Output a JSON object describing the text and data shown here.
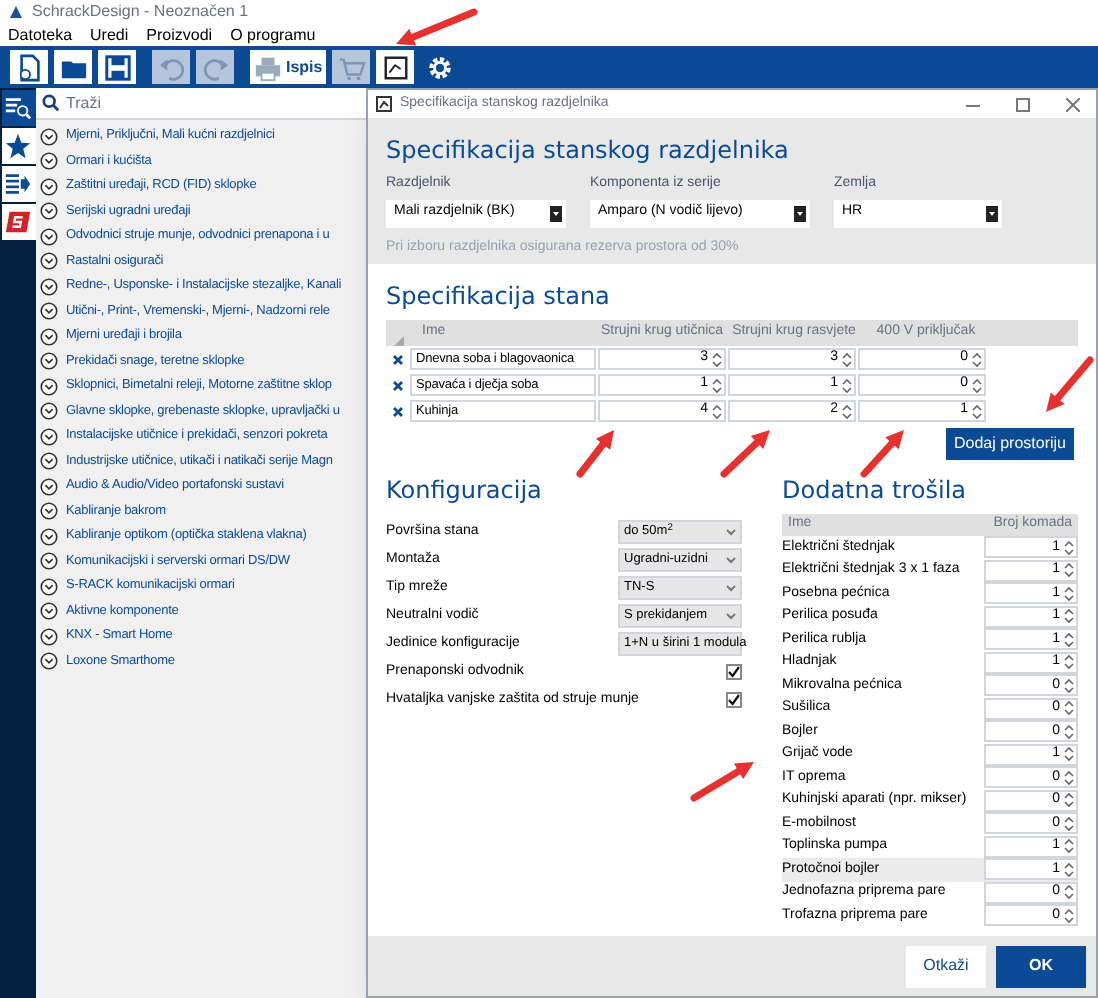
{
  "app_title": "SchrackDesign - Neoznačen 1",
  "menu": [
    "Datoteka",
    "Uredi",
    "Proizvodi",
    "O programu"
  ],
  "toolbar": [
    {
      "kind": "new",
      "disabled": false
    },
    {
      "kind": "open",
      "disabled": false
    },
    {
      "kind": "save",
      "disabled": false
    },
    {
      "kind": "undo",
      "disabled": true
    },
    {
      "kind": "redo",
      "disabled": true
    },
    {
      "kind": "print",
      "label": "Ispis",
      "disabled": false
    },
    {
      "kind": "cart",
      "disabled": true
    },
    {
      "kind": "spec",
      "disabled": false
    },
    {
      "kind": "settings",
      "disabled": false
    }
  ],
  "rail": [
    {
      "kind": "search-list",
      "selected": true
    },
    {
      "kind": "star",
      "selected": false
    },
    {
      "kind": "list-arrow",
      "selected": false
    },
    {
      "kind": "logo",
      "selected": false
    }
  ],
  "search": {
    "placeholder": "Traži"
  },
  "categories": [
    "Mjerni, Priključni, Mali kućni razdjelnici",
    "Ormari i kućišta",
    "Zaštitni uređaji, RCD (FID) sklopke",
    "Serijski ugradni uređaji",
    "Odvodnici struje munje, odvodnici prenapona i u",
    "Rastalni osigurači",
    "Redne-, Usponske- i Instalacijske stezaljke, Kanali",
    "Utični-, Print-, Vremenski-, Mjerni-, Nadzorni rele",
    "Mjerni uređaji i brojila",
    "Prekidači snage, teretne sklopke",
    "Sklopnici, Bimetalni releji, Motorne zaštitne sklop",
    "Glavne sklopke, grebenaste sklopke, upravljački u",
    "Instalacijske utičnice i prekidači, senzori pokreta",
    "Industrijske utičnice, utikači i natikači serije Magn",
    "Audio & Audio/Video portafonski sustavi",
    "Kabliranje bakrom",
    "Kabliranje optikom (optička staklena vlakna)",
    "Komunikacijski i serverski ormari DS/DW",
    "S-RACK komunikacijski ormari",
    "Aktivne komponente",
    "KNX - Smart Home",
    "Loxone Smarthome"
  ],
  "dialog": {
    "title": "Specifikacija stanskog razdjelnika",
    "heading": "Specifikacija stanskog razdjelnika",
    "fields": [
      {
        "label": "Razdjelnik",
        "value": "Mali razdjelnik (BK)"
      },
      {
        "label": "Komponenta iz serije",
        "value": "Amparo (N vodič lijevo)"
      },
      {
        "label": "Zemlja",
        "value": "HR"
      }
    ],
    "note": "Pri izboru razdjelnika osigurana rezerva prostora od 30%",
    "apartment": {
      "heading": "Specifikacija stana",
      "columns": [
        "Ime",
        "Strujni krug utičnica",
        "Strujni krug rasvjete",
        "400 V priključak"
      ],
      "rows": [
        {
          "name": "Dnevna soba i blagovaonica",
          "values": [
            "3",
            "3",
            "0"
          ]
        },
        {
          "name": "Spavaća i dječja soba",
          "values": [
            "1",
            "1",
            "0"
          ]
        },
        {
          "name": "Kuhinja",
          "values": [
            "4",
            "2",
            "1"
          ]
        }
      ],
      "add_button": "Dodaj prostoriju"
    },
    "config": {
      "heading": "Konfiguracija",
      "rows": [
        {
          "kind": "select",
          "label": "Površina stana",
          "value": "do 50m$^{2}$"
        },
        {
          "kind": "select",
          "label": "Montaža",
          "value": "Ugradni-uzidni"
        },
        {
          "kind": "select",
          "label": "Tip mreže",
          "value": "TN-S"
        },
        {
          "kind": "select",
          "label": "Neutralni vodič",
          "value": "S prekidanjem"
        },
        {
          "kind": "select",
          "label": "Jedinice konfiguracije",
          "value": "1+N u širini 1 modula"
        },
        {
          "kind": "checkbox",
          "label": "Prenaponski odvodnik",
          "checked": true
        },
        {
          "kind": "checkbox",
          "label": "Hvataljka vanjske zaštita od struje munje",
          "checked": true
        }
      ]
    },
    "consumers": {
      "heading": "Dodatna trošila",
      "columns": [
        "Ime",
        "Broj komada"
      ],
      "rows": [
        {
          "name": "Električni štednjak",
          "count": "1",
          "selected": false
        },
        {
          "name": "Električni štednjak 3 x 1 faza",
          "count": "1",
          "selected": false
        },
        {
          "name": "Posebna pećnica",
          "count": "1",
          "selected": false
        },
        {
          "name": "Perilica posuđa",
          "count": "1",
          "selected": false
        },
        {
          "name": "Perilica rublja",
          "count": "1",
          "selected": false
        },
        {
          "name": "Hladnjak",
          "count": "1",
          "selected": false
        },
        {
          "name": "Mikrovalna pećnica",
          "count": "0",
          "selected": false
        },
        {
          "name": "Sušilica",
          "count": "0",
          "selected": false
        },
        {
          "name": "Bojler",
          "count": "0",
          "selected": false
        },
        {
          "name": "Grijač vode",
          "count": "1",
          "selected": false
        },
        {
          "name": "IT oprema",
          "count": "0",
          "selected": false
        },
        {
          "name": "Kuhinjski aparati (npr. mikser)",
          "count": "0",
          "selected": false
        },
        {
          "name": "E-mobilnost",
          "count": "0",
          "selected": false
        },
        {
          "name": "Toplinska pumpa",
          "count": "1",
          "selected": false
        },
        {
          "name": "Protočnoi bojler",
          "count": "1",
          "selected": true
        },
        {
          "name": "Jednofazna priprema pare",
          "count": "0",
          "selected": false
        },
        {
          "name": "Trofazna priprema pare",
          "count": "0",
          "selected": false
        }
      ]
    },
    "buttons": [
      {
        "label": "Otkaži",
        "primary": false
      },
      {
        "label": "OK",
        "primary": true
      }
    ]
  }
}
